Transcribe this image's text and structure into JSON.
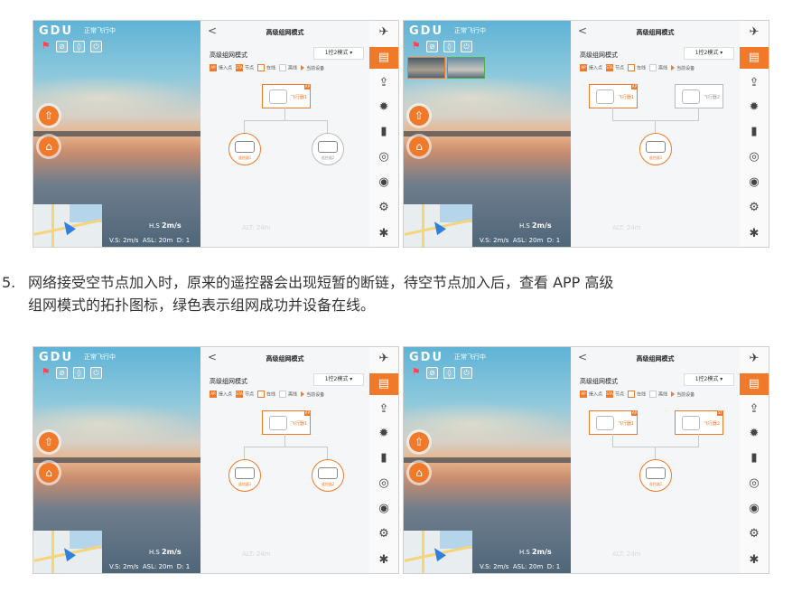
{
  "app": {
    "logo": "GDU",
    "flight_status": "正常飞行中",
    "icons": [
      "bell-icon",
      "no-signal-icon",
      "diamond-icon",
      "power-icon"
    ]
  },
  "telemetry": {
    "hs_label": "H.S",
    "hs_value": "2m/s",
    "vs": "V.S: 2m/s",
    "asl": "ASL: 20m",
    "dist": "D: 1",
    "alt": "ALT: 24m"
  },
  "panel": {
    "back": "<",
    "title": "高级组网模式",
    "mode_label": "高级组网模式",
    "mode_value": "1控2模式",
    "legend": {
      "ap_tag": "AP",
      "ap_text": "接入点",
      "sta_tag": "STA",
      "sta_text": "节点",
      "online": "在线",
      "offline": "离线",
      "current": "当前设备"
    },
    "aircraft_1": "飞行器1",
    "aircraft_2": "飞行器2",
    "controller_1": "遥控器1",
    "controller_2": "遥控器2"
  },
  "sidebar": {
    "items": [
      "drone-icon",
      "remote-controller-icon",
      "upload-icon",
      "propeller-icon",
      "battery-icon",
      "target-icon",
      "camera-icon",
      "gimbal-icon",
      "settings-icon"
    ]
  },
  "paragraph": {
    "number": "5.",
    "line1": "网络接受空节点加入时，原来的遥控器会出现短暂的断链，待空节点加入后，查看 APP 高级",
    "line2": "组网模式的拓扑图标，绿色表示组网成功并设备在线。"
  },
  "colors": {
    "accent": "#f07a2a",
    "online_green": "#4caf50"
  }
}
